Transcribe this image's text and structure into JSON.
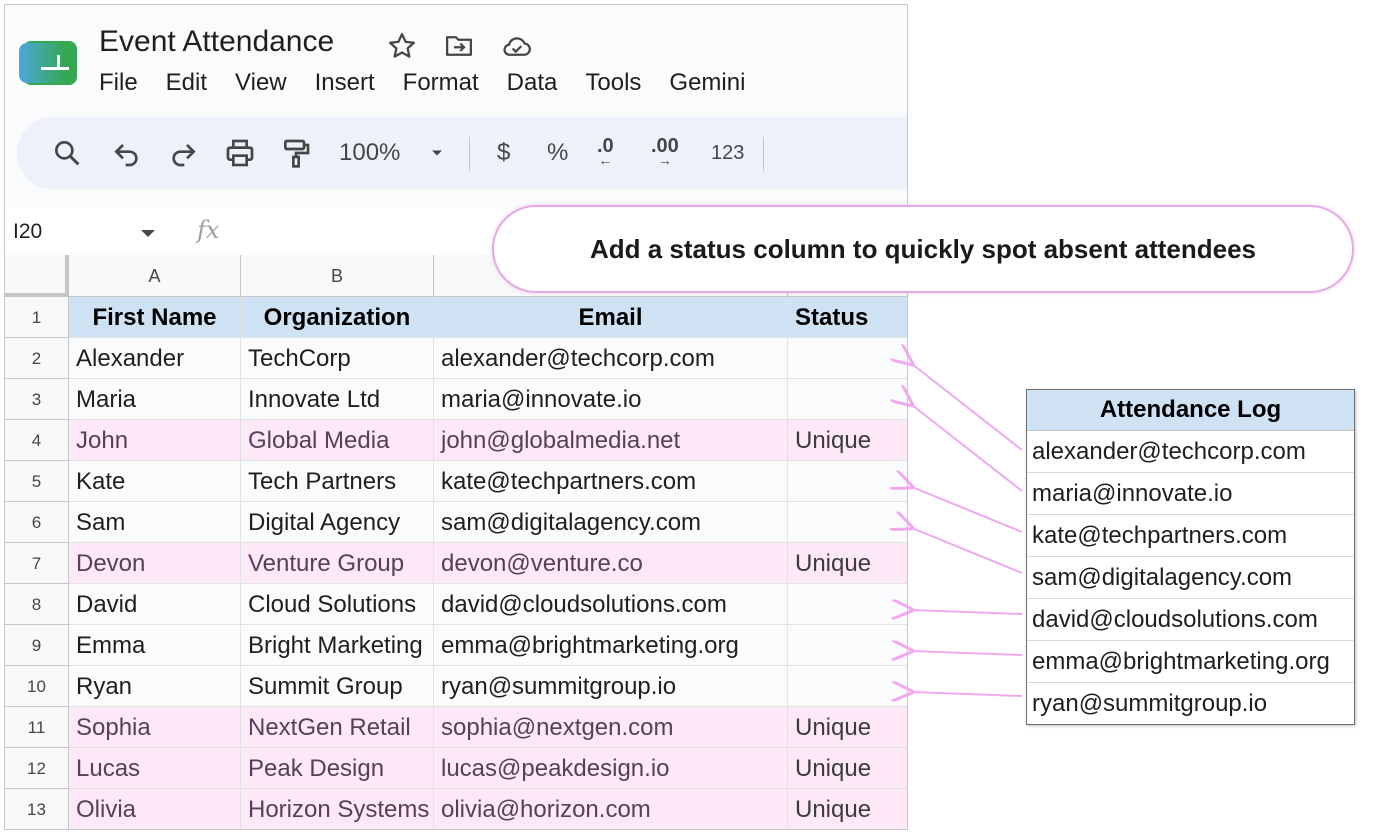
{
  "app": {
    "title": "Event Attendance",
    "icons": [
      "star-icon",
      "move-to-folder-icon",
      "cloud-saved-icon"
    ]
  },
  "menu": [
    "File",
    "Edit",
    "View",
    "Insert",
    "Format",
    "Data",
    "Tools",
    "Gemini"
  ],
  "toolbar": {
    "zoom": "100%",
    "currency": "$",
    "percent": "%",
    "decrease_decimal": ".0",
    "increase_decimal": ".00",
    "number_format": "123"
  },
  "formula_bar": {
    "cell_ref": "I20",
    "fx": "fx"
  },
  "columns": [
    "A",
    "B"
  ],
  "header_row": {
    "num": "1",
    "first_name": "First Name",
    "organization": "Organization",
    "email": "Email",
    "status": "Status"
  },
  "rows": [
    {
      "num": "2",
      "first": "Alexander",
      "org": "TechCorp",
      "email": "alexander@techcorp.com",
      "status": ""
    },
    {
      "num": "3",
      "first": "Maria",
      "org": "Innovate Ltd",
      "email": "maria@innovate.io",
      "status": ""
    },
    {
      "num": "4",
      "first": "John",
      "org": "Global Media",
      "email": "john@globalmedia.net",
      "status": "Unique"
    },
    {
      "num": "5",
      "first": "Kate",
      "org": "Tech Partners",
      "email": "kate@techpartners.com",
      "status": ""
    },
    {
      "num": "6",
      "first": "Sam",
      "org": "Digital Agency",
      "email": "sam@digitalagency.com",
      "status": ""
    },
    {
      "num": "7",
      "first": "Devon",
      "org": "Venture Group",
      "email": "devon@venture.co",
      "status": "Unique"
    },
    {
      "num": "8",
      "first": "David",
      "org": "Cloud Solutions",
      "email": "david@cloudsolutions.com",
      "status": ""
    },
    {
      "num": "9",
      "first": "Emma",
      "org": "Bright Marketing",
      "email": "emma@brightmarketing.org",
      "status": ""
    },
    {
      "num": "10",
      "first": "Ryan",
      "org": "Summit Group",
      "email": "ryan@summitgroup.io",
      "status": ""
    },
    {
      "num": "11",
      "first": "Sophia",
      "org": "NextGen Retail",
      "email": "sophia@nextgen.com",
      "status": "Unique"
    },
    {
      "num": "12",
      "first": "Lucas",
      "org": "Peak Design",
      "email": "lucas@peakdesign.io",
      "status": "Unique"
    },
    {
      "num": "13",
      "first": "Olivia",
      "org": "Horizon Systems",
      "email": "olivia@horizon.com",
      "status": "Unique"
    }
  ],
  "callout": "Add a status column to quickly spot absent attendees",
  "attendance_log": {
    "title": "Attendance Log",
    "emails": [
      "alexander@techcorp.com",
      "maria@innovate.io",
      "kate@techpartners.com",
      "sam@digitalagency.com",
      "david@cloudsolutions.com",
      "emma@brightmarketing.org",
      "ryan@summitgroup.io"
    ]
  },
  "colors": {
    "header_fill": "#cfe2f3",
    "unique_row_fill": "#fde8f7",
    "arrow": "#f0a8f0",
    "logo_green": "#34a853",
    "logo_blue": "#4ea6dc"
  }
}
